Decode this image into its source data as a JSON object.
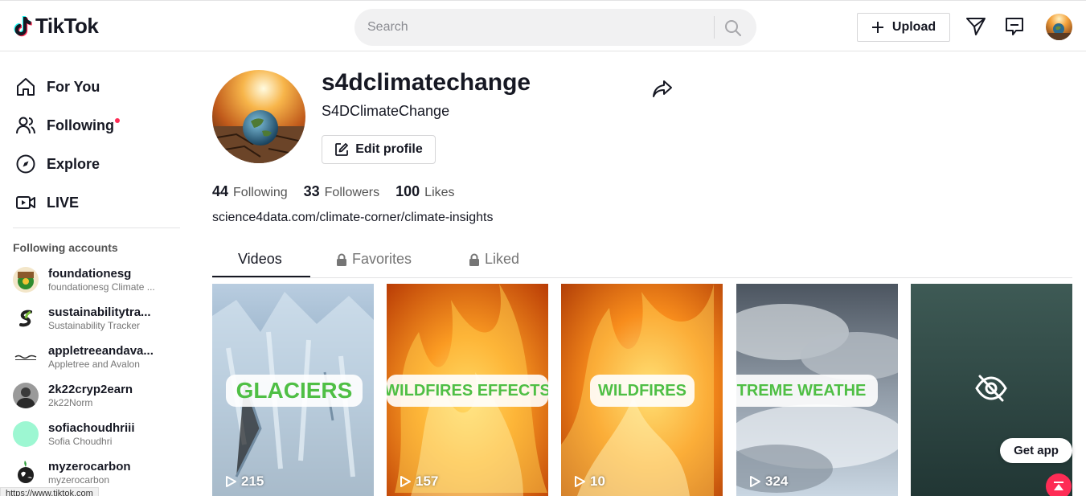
{
  "header": {
    "logo_text": "TikTok",
    "search_placeholder": "Search",
    "upload_label": "Upload",
    "icons": [
      "send-icon",
      "inbox-icon"
    ]
  },
  "sidebar": {
    "nav": [
      {
        "label": "For You",
        "icon": "home-icon"
      },
      {
        "label": "Following",
        "icon": "following-icon",
        "notification_dot": true
      },
      {
        "label": "Explore",
        "icon": "compass-icon"
      },
      {
        "label": "LIVE",
        "icon": "live-icon"
      }
    ],
    "following_heading": "Following accounts",
    "accounts": [
      {
        "username": "foundationesg",
        "name": "foundationesg Climate ..."
      },
      {
        "username": "sustainabilitytra...",
        "name": "Sustainability Tracker"
      },
      {
        "username": "appletreeandava...",
        "name": "Appletree and Avalon"
      },
      {
        "username": "2k22cryp2earn",
        "name": "2k22Norm"
      },
      {
        "username": "sofiachoudhriii",
        "name": "Sofia Choudhri"
      },
      {
        "username": "myzerocarbon",
        "name": "myzerocarbon"
      }
    ],
    "status_url": "https://www.tiktok.com"
  },
  "profile": {
    "username": "s4dclimatechange",
    "nickname": "S4DClimateChange",
    "edit_label": "Edit profile",
    "stats": [
      {
        "num": "44",
        "label": "Following"
      },
      {
        "num": "33",
        "label": "Followers"
      },
      {
        "num": "100",
        "label": "Likes"
      }
    ],
    "bio_link": "science4data.com/climate-corner/climate-insights"
  },
  "tabs": [
    {
      "label": "Videos",
      "active": true,
      "locked": false
    },
    {
      "label": "Favorites",
      "active": false,
      "locked": true
    },
    {
      "label": "Liked",
      "active": false,
      "locked": true
    }
  ],
  "videos": [
    {
      "label": "GLACIERS",
      "views": "215"
    },
    {
      "label": "WILDFIRES EFFECTS",
      "views": "157"
    },
    {
      "label": "WILDFIRES",
      "views": "10"
    },
    {
      "label": "TREME WEATHE",
      "views": "324"
    },
    {
      "label": "",
      "views": "",
      "hidden": true
    }
  ],
  "get_app_label": "Get app",
  "colors": {
    "accent": "#fe2c55",
    "label_green": "#4fbf45"
  }
}
